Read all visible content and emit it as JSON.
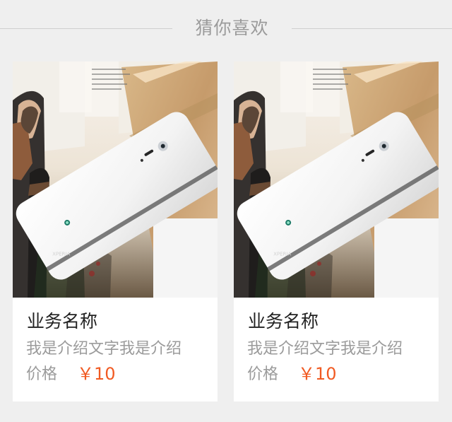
{
  "section": {
    "title": "猜你喜欢"
  },
  "products": [
    {
      "name": "业务名称",
      "description": "我是介绍文字我是介绍",
      "price_label": "价格",
      "price": "￥10"
    },
    {
      "name": "业务名称",
      "description": "我是介绍文字我是介绍",
      "price_label": "价格",
      "price": "￥10"
    }
  ],
  "colors": {
    "background": "#efefef",
    "divider": "#cfcfcf",
    "title": "#9b9b9b",
    "price": "#f15a22"
  }
}
